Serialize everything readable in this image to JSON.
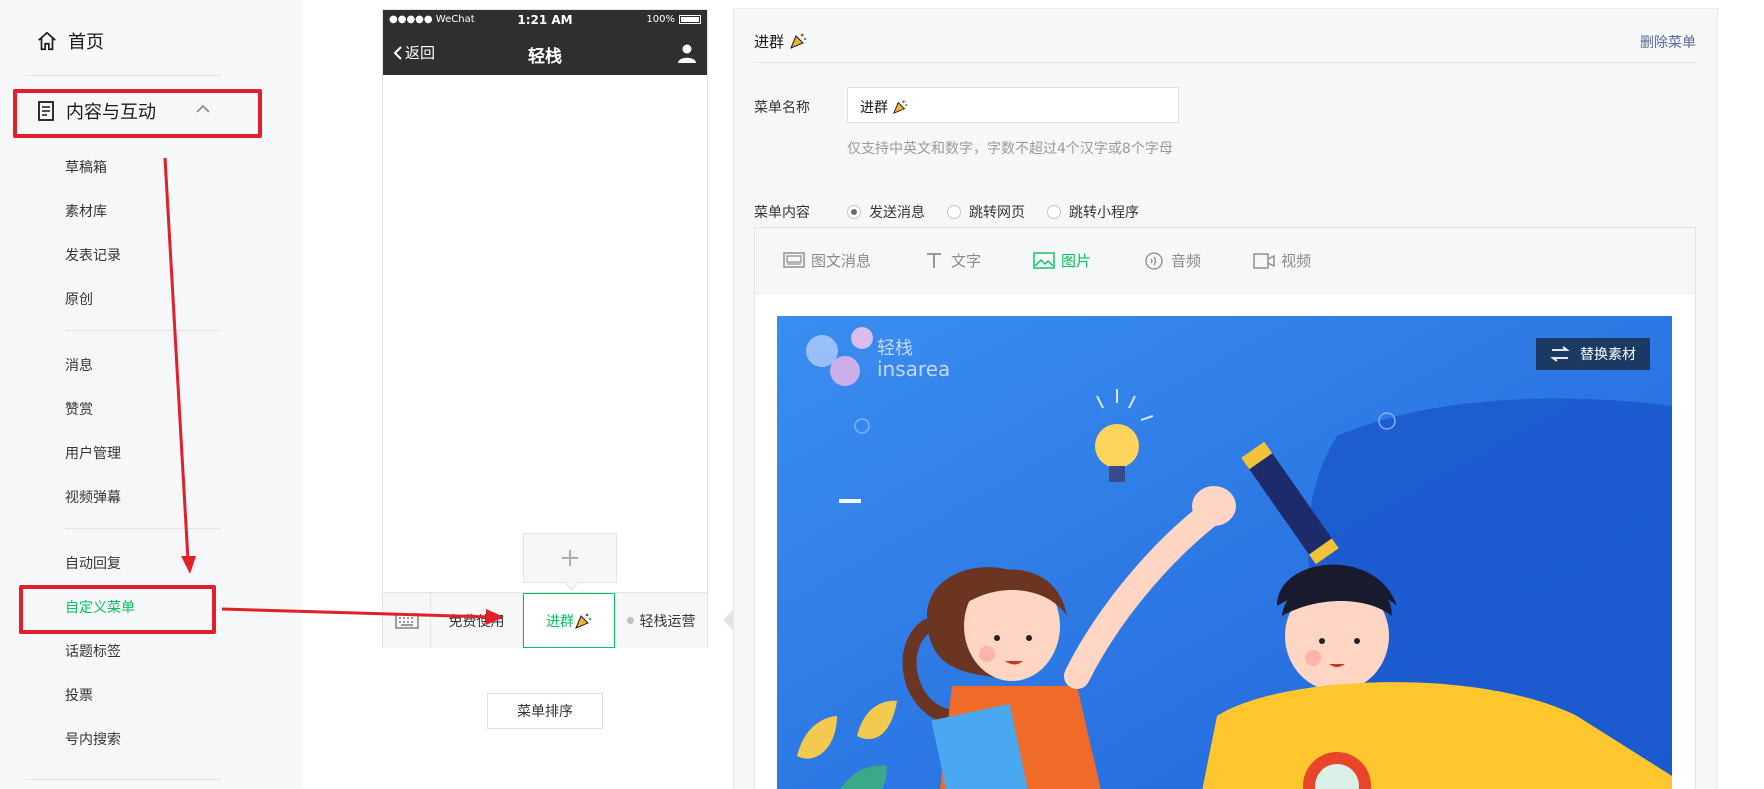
{
  "sidebar": {
    "home": "首页",
    "group": "内容与互动",
    "items": [
      {
        "label": "草稿箱"
      },
      {
        "label": "素材库"
      },
      {
        "label": "发表记录"
      },
      {
        "label": "原创"
      },
      {
        "label": "消息"
      },
      {
        "label": "赞赏"
      },
      {
        "label": "用户管理"
      },
      {
        "label": "视频弹幕"
      },
      {
        "label": "自动回复"
      },
      {
        "label": "自定义菜单"
      },
      {
        "label": "话题标签"
      },
      {
        "label": "投票"
      },
      {
        "label": "号内搜索"
      }
    ]
  },
  "phone": {
    "status_left": "●●●●● WeChat",
    "status_time": "1:21 AM",
    "status_battery": "100%",
    "back": "返回",
    "title": "轻栈",
    "menu": [
      "免费使用",
      "进群",
      "轻栈运营"
    ],
    "sort_button": "菜单排序"
  },
  "editor": {
    "title": "进群",
    "delete": "删除菜单",
    "name_label": "菜单名称",
    "name_value": "进群",
    "name_hint": "仅支持中英文和数字，字数不超过4个汉字或8个字母",
    "content_label": "菜单内容",
    "radios": [
      "发送消息",
      "跳转网页",
      "跳转小程序"
    ],
    "tabs": [
      "图文消息",
      "文字",
      "图片",
      "音频",
      "视频"
    ],
    "replace": "替换素材",
    "brand_cn": "轻栈",
    "brand_en": "insarea"
  },
  "colors": {
    "accent": "#07c160",
    "highlight": "#e0202a",
    "link": "#576b95",
    "image_bg": "#2f7fe8"
  }
}
